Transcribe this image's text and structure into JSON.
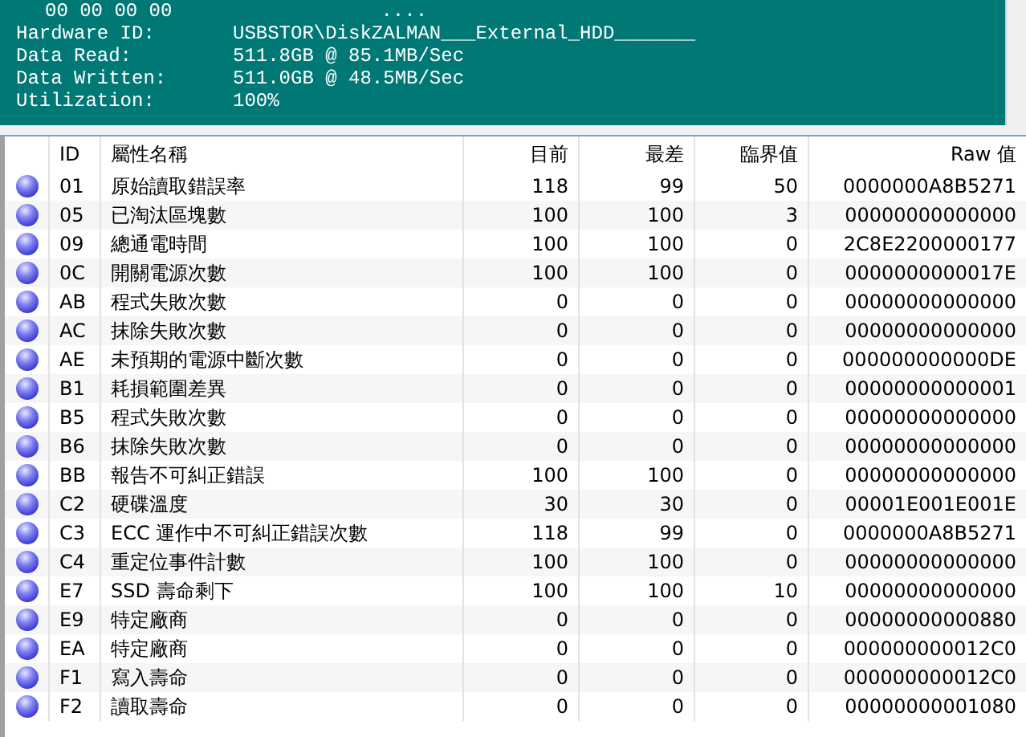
{
  "info_panel": {
    "top_line": [
      "00 00 00 00",
      "...."
    ],
    "fields": [
      {
        "label": "Hardware ID:",
        "value": "USBSTOR\\DiskZALMAN___External_HDD_______"
      },
      {
        "label": "Data Read:",
        "value": "511.8GB @ 85.1MB/Sec"
      },
      {
        "label": "Data Written:",
        "value": "511.0GB @ 48.5MB/Sec"
      },
      {
        "label": "Utilization:",
        "value": "100%"
      }
    ]
  },
  "table": {
    "columns": [
      "ID",
      "屬性名稱",
      "目前",
      "最差",
      "臨界值",
      "Raw 值"
    ],
    "rows": [
      {
        "id": "01",
        "name": "原始讀取錯誤率",
        "current": "118",
        "worst": "99",
        "threshold": "50",
        "raw": "0000000A8B5271"
      },
      {
        "id": "05",
        "name": "已淘汰區塊數",
        "current": "100",
        "worst": "100",
        "threshold": "3",
        "raw": "00000000000000"
      },
      {
        "id": "09",
        "name": "總通電時間",
        "current": "100",
        "worst": "100",
        "threshold": "0",
        "raw": "2C8E2200000177"
      },
      {
        "id": "0C",
        "name": "開關電源次數",
        "current": "100",
        "worst": "100",
        "threshold": "0",
        "raw": "0000000000017E"
      },
      {
        "id": "AB",
        "name": "程式失敗次數",
        "current": "0",
        "worst": "0",
        "threshold": "0",
        "raw": "00000000000000"
      },
      {
        "id": "AC",
        "name": "抹除失敗次數",
        "current": "0",
        "worst": "0",
        "threshold": "0",
        "raw": "00000000000000"
      },
      {
        "id": "AE",
        "name": "未預期的電源中斷次數",
        "current": "0",
        "worst": "0",
        "threshold": "0",
        "raw": "000000000000DE"
      },
      {
        "id": "B1",
        "name": "耗損範圍差異",
        "current": "0",
        "worst": "0",
        "threshold": "0",
        "raw": "00000000000001"
      },
      {
        "id": "B5",
        "name": "程式失敗次數",
        "current": "0",
        "worst": "0",
        "threshold": "0",
        "raw": "00000000000000"
      },
      {
        "id": "B6",
        "name": "抹除失敗次數",
        "current": "0",
        "worst": "0",
        "threshold": "0",
        "raw": "00000000000000"
      },
      {
        "id": "BB",
        "name": "報告不可糾正錯誤",
        "current": "100",
        "worst": "100",
        "threshold": "0",
        "raw": "00000000000000"
      },
      {
        "id": "C2",
        "name": "硬碟溫度",
        "current": "30",
        "worst": "30",
        "threshold": "0",
        "raw": "00001E001E001E"
      },
      {
        "id": "C3",
        "name": "ECC 運作中不可糾正錯誤次數",
        "current": "118",
        "worst": "99",
        "threshold": "0",
        "raw": "0000000A8B5271"
      },
      {
        "id": "C4",
        "name": "重定位事件計數",
        "current": "100",
        "worst": "100",
        "threshold": "0",
        "raw": "00000000000000"
      },
      {
        "id": "E7",
        "name": "SSD 壽命剩下",
        "current": "100",
        "worst": "100",
        "threshold": "10",
        "raw": "00000000000000"
      },
      {
        "id": "E9",
        "name": "特定廠商",
        "current": "0",
        "worst": "0",
        "threshold": "0",
        "raw": "00000000000880"
      },
      {
        "id": "EA",
        "name": "特定廠商",
        "current": "0",
        "worst": "0",
        "threshold": "0",
        "raw": "000000000012C0"
      },
      {
        "id": "F1",
        "name": "寫入壽命",
        "current": "0",
        "worst": "0",
        "threshold": "0",
        "raw": "000000000012C0"
      },
      {
        "id": "F2",
        "name": "讀取壽命",
        "current": "0",
        "worst": "0",
        "threshold": "0",
        "raw": "00000000001080"
      }
    ]
  }
}
